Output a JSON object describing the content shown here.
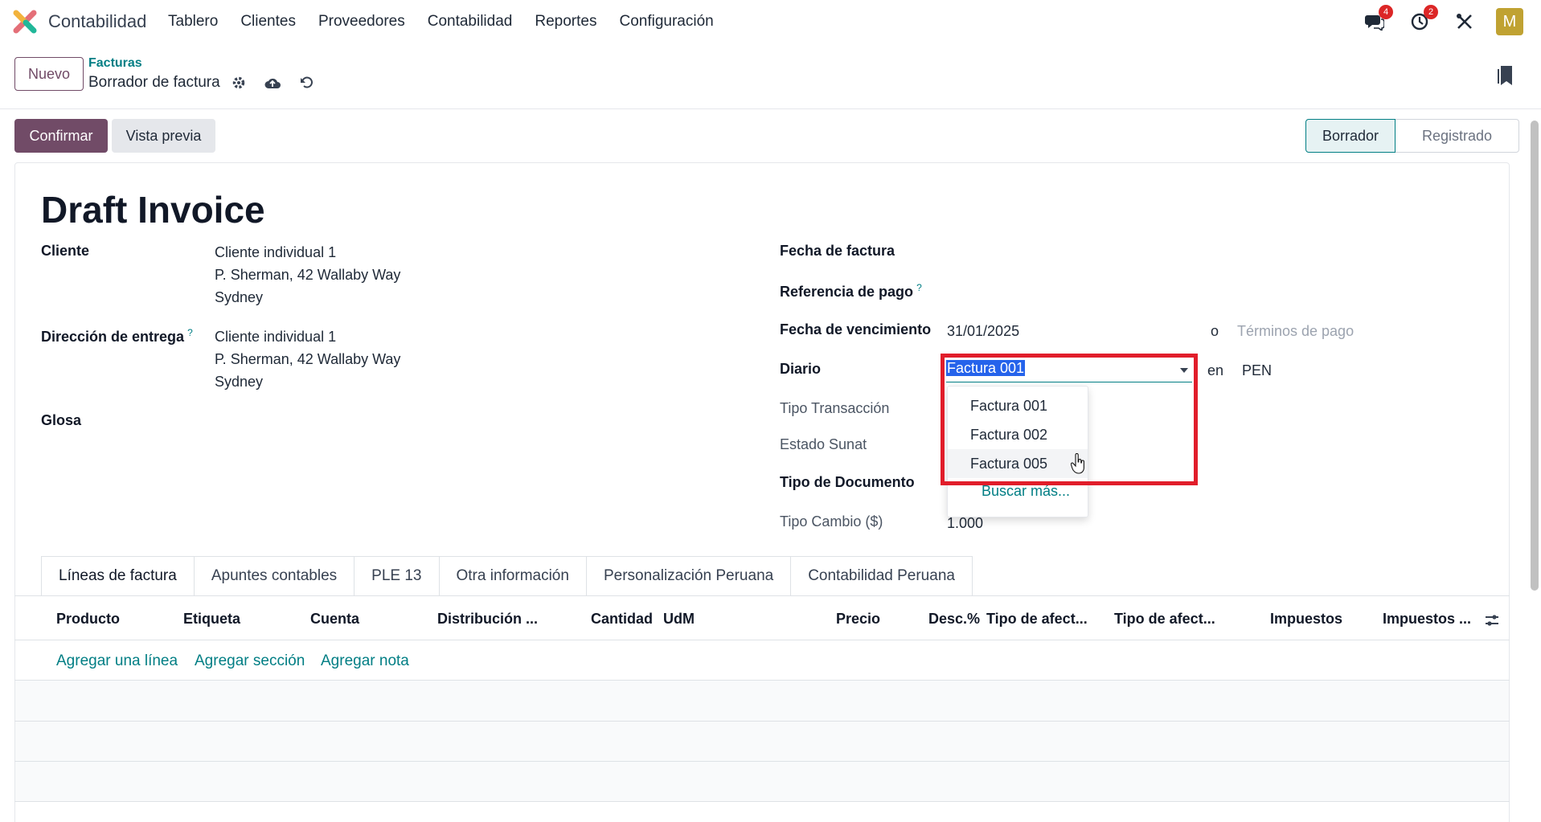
{
  "app": {
    "name": "Contabilidad"
  },
  "menu": [
    "Tablero",
    "Clientes",
    "Proveedores",
    "Contabilidad",
    "Reportes",
    "Configuración"
  ],
  "nav": {
    "messages_count": "4",
    "activities_count": "2",
    "avatar_letter": "M"
  },
  "control": {
    "new_label": "Nuevo",
    "breadcrumb_parent": "Facturas",
    "breadcrumb_current": "Borrador de factura"
  },
  "status": {
    "confirm_label": "Confirmar",
    "preview_label": "Vista previa",
    "stages": [
      "Borrador",
      "Registrado"
    ]
  },
  "form": {
    "title": "Draft Invoice",
    "cliente_label": "Cliente",
    "cliente_lines": [
      "Cliente individual 1",
      "P. Sherman, 42 Wallaby Way",
      "Sydney"
    ],
    "entrega_label": "Dirección de entrega",
    "entrega_lines": [
      "Cliente individual 1",
      "P. Sherman, 42 Wallaby Way",
      "Sydney"
    ],
    "glosa_label": "Glosa",
    "fecha_factura_label": "Fecha de factura",
    "referencia_label": "Referencia de pago",
    "vencimiento_label": "Fecha de vencimiento",
    "vencimiento_value": "31/01/2025",
    "o_label": "o",
    "terminos_placeholder": "Términos de pago",
    "diario_label": "Diario",
    "diario_value": "Factura 001",
    "en_label": "en",
    "currency": "PEN",
    "tipo_transaccion_label": "Tipo Transacción",
    "estado_sunat_label": "Estado Sunat",
    "tipo_documento_label": "Tipo de Documento",
    "tipo_cambio_label": "Tipo Cambio ($)",
    "tipo_cambio_value": "1.000",
    "help_mark": "?"
  },
  "dropdown": {
    "options": [
      "Factura 001",
      "Factura 002",
      "Factura 005"
    ],
    "more_label": "Buscar más..."
  },
  "tabs": [
    "Líneas de factura",
    "Apuntes contables",
    "PLE 13",
    "Otra información",
    "Personalización Peruana",
    "Contabilidad Peruana"
  ],
  "table": {
    "headers": [
      "Producto",
      "Etiqueta",
      "Cuenta",
      "Distribución ...",
      "Cantidad",
      "UdM",
      "Precio",
      "Desc.%",
      "Tipo de afect...",
      "Tipo de afect...",
      "Impuestos",
      "Impuestos ..."
    ],
    "add_line": "Agregar una línea",
    "add_section": "Agregar sección",
    "add_note": "Agregar nota"
  },
  "colors": {
    "primary": "#714b67",
    "link": "#017e84",
    "highlight": "#e11d2a"
  }
}
